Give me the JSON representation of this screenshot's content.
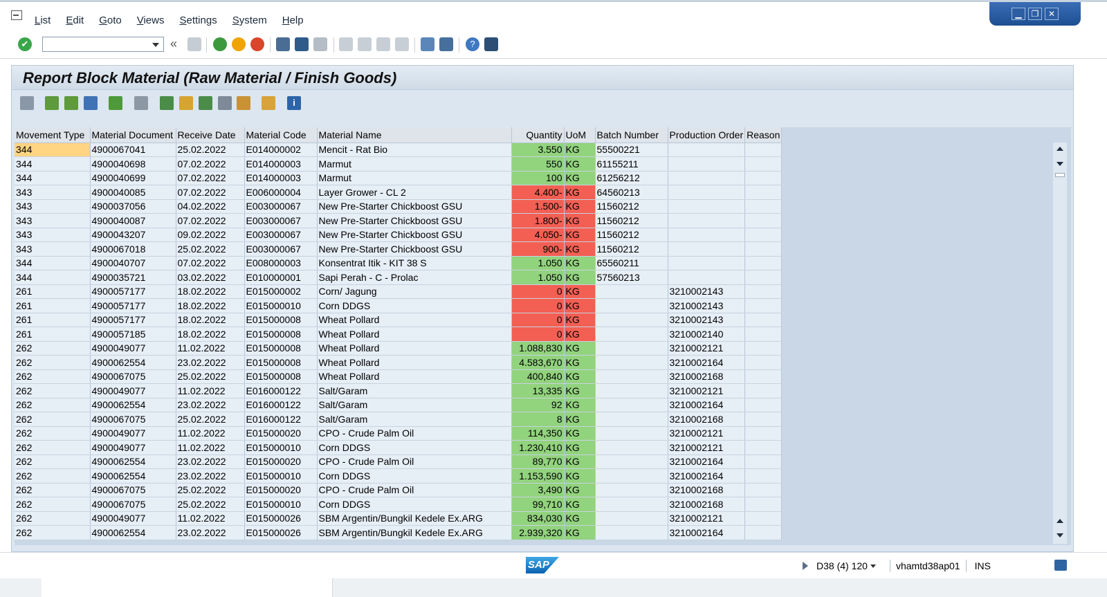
{
  "menu": {
    "items": [
      "List",
      "Edit",
      "Goto",
      "Views",
      "Settings",
      "System",
      "Help"
    ]
  },
  "window_controls": {
    "minimize": "▁",
    "restore": "❐",
    "close": "✕"
  },
  "toolbar": {
    "command_field_value": "",
    "icons": [
      "enter-icon",
      "back-icon",
      "save-icon",
      "back-green-icon",
      "exit-icon",
      "cancel-icon",
      "print-icon",
      "find-icon",
      "find-next-icon",
      "first-page-icon",
      "previous-page-icon",
      "next-page-icon",
      "last-page-icon",
      "create-session-icon",
      "shortcut-icon",
      "help-icon",
      "customize-layout-icon"
    ],
    "back_glyph": "«"
  },
  "report": {
    "title": "Report Block Material (Raw Material / Finish Goods)"
  },
  "alv_toolbar": {
    "icons": [
      "details-icon",
      "sort-ascending-icon",
      "sort-descending-icon",
      "filter-icon",
      "sum-icon",
      "print-preview-icon",
      "export-spreadsheet-icon",
      "select-layout-icon",
      "save-layout-icon",
      "abc-analysis-icon",
      "graphic-icon",
      "grid-layout-icon",
      "information-icon"
    ]
  },
  "grid": {
    "columns": [
      "Movement Type",
      "Material Document",
      "Receive Date",
      "Material Code",
      "Material Name",
      "Quantity",
      "UoM",
      "Batch Number",
      "Production Order",
      "Reason"
    ],
    "rows": [
      {
        "mt": "344",
        "doc": "4900067041",
        "date": "25.02.2022",
        "code": "E014000002",
        "name": "Mencit - Rat Bio",
        "qty": "3.550",
        "uom": "KG",
        "batch": "55500221",
        "po": "",
        "reason": "",
        "status": "green"
      },
      {
        "mt": "344",
        "doc": "4900040698",
        "date": "07.02.2022",
        "code": "E014000003",
        "name": "Marmut",
        "qty": "550",
        "uom": "KG",
        "batch": "61155211",
        "po": "",
        "reason": "",
        "status": "green"
      },
      {
        "mt": "344",
        "doc": "4900040699",
        "date": "07.02.2022",
        "code": "E014000003",
        "name": "Marmut",
        "qty": "100",
        "uom": "KG",
        "batch": "61256212",
        "po": "",
        "reason": "",
        "status": "green"
      },
      {
        "mt": "343",
        "doc": "4900040085",
        "date": "07.02.2022",
        "code": "E006000004",
        "name": "Layer Grower - CL 2",
        "qty": "4.400-",
        "uom": "KG",
        "batch": "64560213",
        "po": "",
        "reason": "",
        "status": "red"
      },
      {
        "mt": "343",
        "doc": "4900037056",
        "date": "04.02.2022",
        "code": "E003000067",
        "name": "New Pre-Starter Chickboost GSU",
        "qty": "1.500-",
        "uom": "KG",
        "batch": "11560212",
        "po": "",
        "reason": "",
        "status": "red"
      },
      {
        "mt": "343",
        "doc": "4900040087",
        "date": "07.02.2022",
        "code": "E003000067",
        "name": "New Pre-Starter Chickboost GSU",
        "qty": "1.800-",
        "uom": "KG",
        "batch": "11560212",
        "po": "",
        "reason": "",
        "status": "red"
      },
      {
        "mt": "343",
        "doc": "4900043207",
        "date": "09.02.2022",
        "code": "E003000067",
        "name": "New Pre-Starter Chickboost GSU",
        "qty": "4.050-",
        "uom": "KG",
        "batch": "11560212",
        "po": "",
        "reason": "",
        "status": "red"
      },
      {
        "mt": "343",
        "doc": "4900067018",
        "date": "25.02.2022",
        "code": "E003000067",
        "name": "New Pre-Starter Chickboost GSU",
        "qty": "900-",
        "uom": "KG",
        "batch": "11560212",
        "po": "",
        "reason": "",
        "status": "red"
      },
      {
        "mt": "344",
        "doc": "4900040707",
        "date": "07.02.2022",
        "code": "E008000003",
        "name": "Konsentrat Itik - KIT 38 S",
        "qty": "1.050",
        "uom": "KG",
        "batch": "65560211",
        "po": "",
        "reason": "",
        "status": "green"
      },
      {
        "mt": "344",
        "doc": "4900035721",
        "date": "03.02.2022",
        "code": "E010000001",
        "name": "Sapi Perah - C - Prolac",
        "qty": "1.050",
        "uom": "KG",
        "batch": "57560213",
        "po": "",
        "reason": "",
        "status": "green"
      },
      {
        "mt": "261",
        "doc": "4900057177",
        "date": "18.02.2022",
        "code": "E015000002",
        "name": "Corn/ Jagung",
        "qty": "0",
        "uom": "KG",
        "batch": "",
        "po": "3210002143",
        "reason": "",
        "status": "red"
      },
      {
        "mt": "261",
        "doc": "4900057177",
        "date": "18.02.2022",
        "code": "E015000010",
        "name": "Corn DDGS",
        "qty": "0",
        "uom": "KG",
        "batch": "",
        "po": "3210002143",
        "reason": "",
        "status": "red"
      },
      {
        "mt": "261",
        "doc": "4900057177",
        "date": "18.02.2022",
        "code": "E015000008",
        "name": "Wheat Pollard",
        "qty": "0",
        "uom": "KG",
        "batch": "",
        "po": "3210002143",
        "reason": "",
        "status": "red"
      },
      {
        "mt": "261",
        "doc": "4900057185",
        "date": "18.02.2022",
        "code": "E015000008",
        "name": "Wheat Pollard",
        "qty": "0",
        "uom": "KG",
        "batch": "",
        "po": "3210002140",
        "reason": "",
        "status": "red"
      },
      {
        "mt": "262",
        "doc": "4900049077",
        "date": "11.02.2022",
        "code": "E015000008",
        "name": "Wheat Pollard",
        "qty": "1.088,830",
        "uom": "KG",
        "batch": "",
        "po": "3210002121",
        "reason": "",
        "status": "green"
      },
      {
        "mt": "262",
        "doc": "4900062554",
        "date": "23.02.2022",
        "code": "E015000008",
        "name": "Wheat Pollard",
        "qty": "4.583,670",
        "uom": "KG",
        "batch": "",
        "po": "3210002164",
        "reason": "",
        "status": "green"
      },
      {
        "mt": "262",
        "doc": "4900067075",
        "date": "25.02.2022",
        "code": "E015000008",
        "name": "Wheat Pollard",
        "qty": "400,840",
        "uom": "KG",
        "batch": "",
        "po": "3210002168",
        "reason": "",
        "status": "green"
      },
      {
        "mt": "262",
        "doc": "4900049077",
        "date": "11.02.2022",
        "code": "E016000122",
        "name": "Salt/Garam",
        "qty": "13,335",
        "uom": "KG",
        "batch": "",
        "po": "3210002121",
        "reason": "",
        "status": "green"
      },
      {
        "mt": "262",
        "doc": "4900062554",
        "date": "23.02.2022",
        "code": "E016000122",
        "name": "Salt/Garam",
        "qty": "92",
        "uom": "KG",
        "batch": "",
        "po": "3210002164",
        "reason": "",
        "status": "green"
      },
      {
        "mt": "262",
        "doc": "4900067075",
        "date": "25.02.2022",
        "code": "E016000122",
        "name": "Salt/Garam",
        "qty": "8",
        "uom": "KG",
        "batch": "",
        "po": "3210002168",
        "reason": "",
        "status": "green"
      },
      {
        "mt": "262",
        "doc": "4900049077",
        "date": "11.02.2022",
        "code": "E015000020",
        "name": "CPO - Crude Palm Oil",
        "qty": "114,350",
        "uom": "KG",
        "batch": "",
        "po": "3210002121",
        "reason": "",
        "status": "green"
      },
      {
        "mt": "262",
        "doc": "4900049077",
        "date": "11.02.2022",
        "code": "E015000010",
        "name": "Corn DDGS",
        "qty": "1.230,410",
        "uom": "KG",
        "batch": "",
        "po": "3210002121",
        "reason": "",
        "status": "green"
      },
      {
        "mt": "262",
        "doc": "4900062554",
        "date": "23.02.2022",
        "code": "E015000020",
        "name": "CPO - Crude Palm Oil",
        "qty": "89,770",
        "uom": "KG",
        "batch": "",
        "po": "3210002164",
        "reason": "",
        "status": "green"
      },
      {
        "mt": "262",
        "doc": "4900062554",
        "date": "23.02.2022",
        "code": "E015000010",
        "name": "Corn DDGS",
        "qty": "1.153,590",
        "uom": "KG",
        "batch": "",
        "po": "3210002164",
        "reason": "",
        "status": "green"
      },
      {
        "mt": "262",
        "doc": "4900067075",
        "date": "25.02.2022",
        "code": "E015000020",
        "name": "CPO - Crude Palm Oil",
        "qty": "3,490",
        "uom": "KG",
        "batch": "",
        "po": "3210002168",
        "reason": "",
        "status": "green"
      },
      {
        "mt": "262",
        "doc": "4900067075",
        "date": "25.02.2022",
        "code": "E015000010",
        "name": "Corn DDGS",
        "qty": "99,710",
        "uom": "KG",
        "batch": "",
        "po": "3210002168",
        "reason": "",
        "status": "green"
      },
      {
        "mt": "262",
        "doc": "4900049077",
        "date": "11.02.2022",
        "code": "E015000026",
        "name": "SBM Argentin/Bungkil Kedele Ex.ARG",
        "qty": "834,030",
        "uom": "KG",
        "batch": "",
        "po": "3210002121",
        "reason": "",
        "status": "green"
      },
      {
        "mt": "262",
        "doc": "4900062554",
        "date": "23.02.2022",
        "code": "E015000026",
        "name": "SBM Argentin/Bungkil Kedele Ex.ARG",
        "qty": "2.939,320",
        "uom": "KG",
        "batch": "",
        "po": "3210002164",
        "reason": "",
        "status": "green"
      }
    ]
  },
  "colors": {
    "positive": "#92d37d",
    "negative": "#f35f53",
    "selected": "#ffd482"
  },
  "status": {
    "logo": "SAP",
    "system": "D38 (4) 120",
    "server": "vhamtd38ap01",
    "mode": "INS"
  }
}
